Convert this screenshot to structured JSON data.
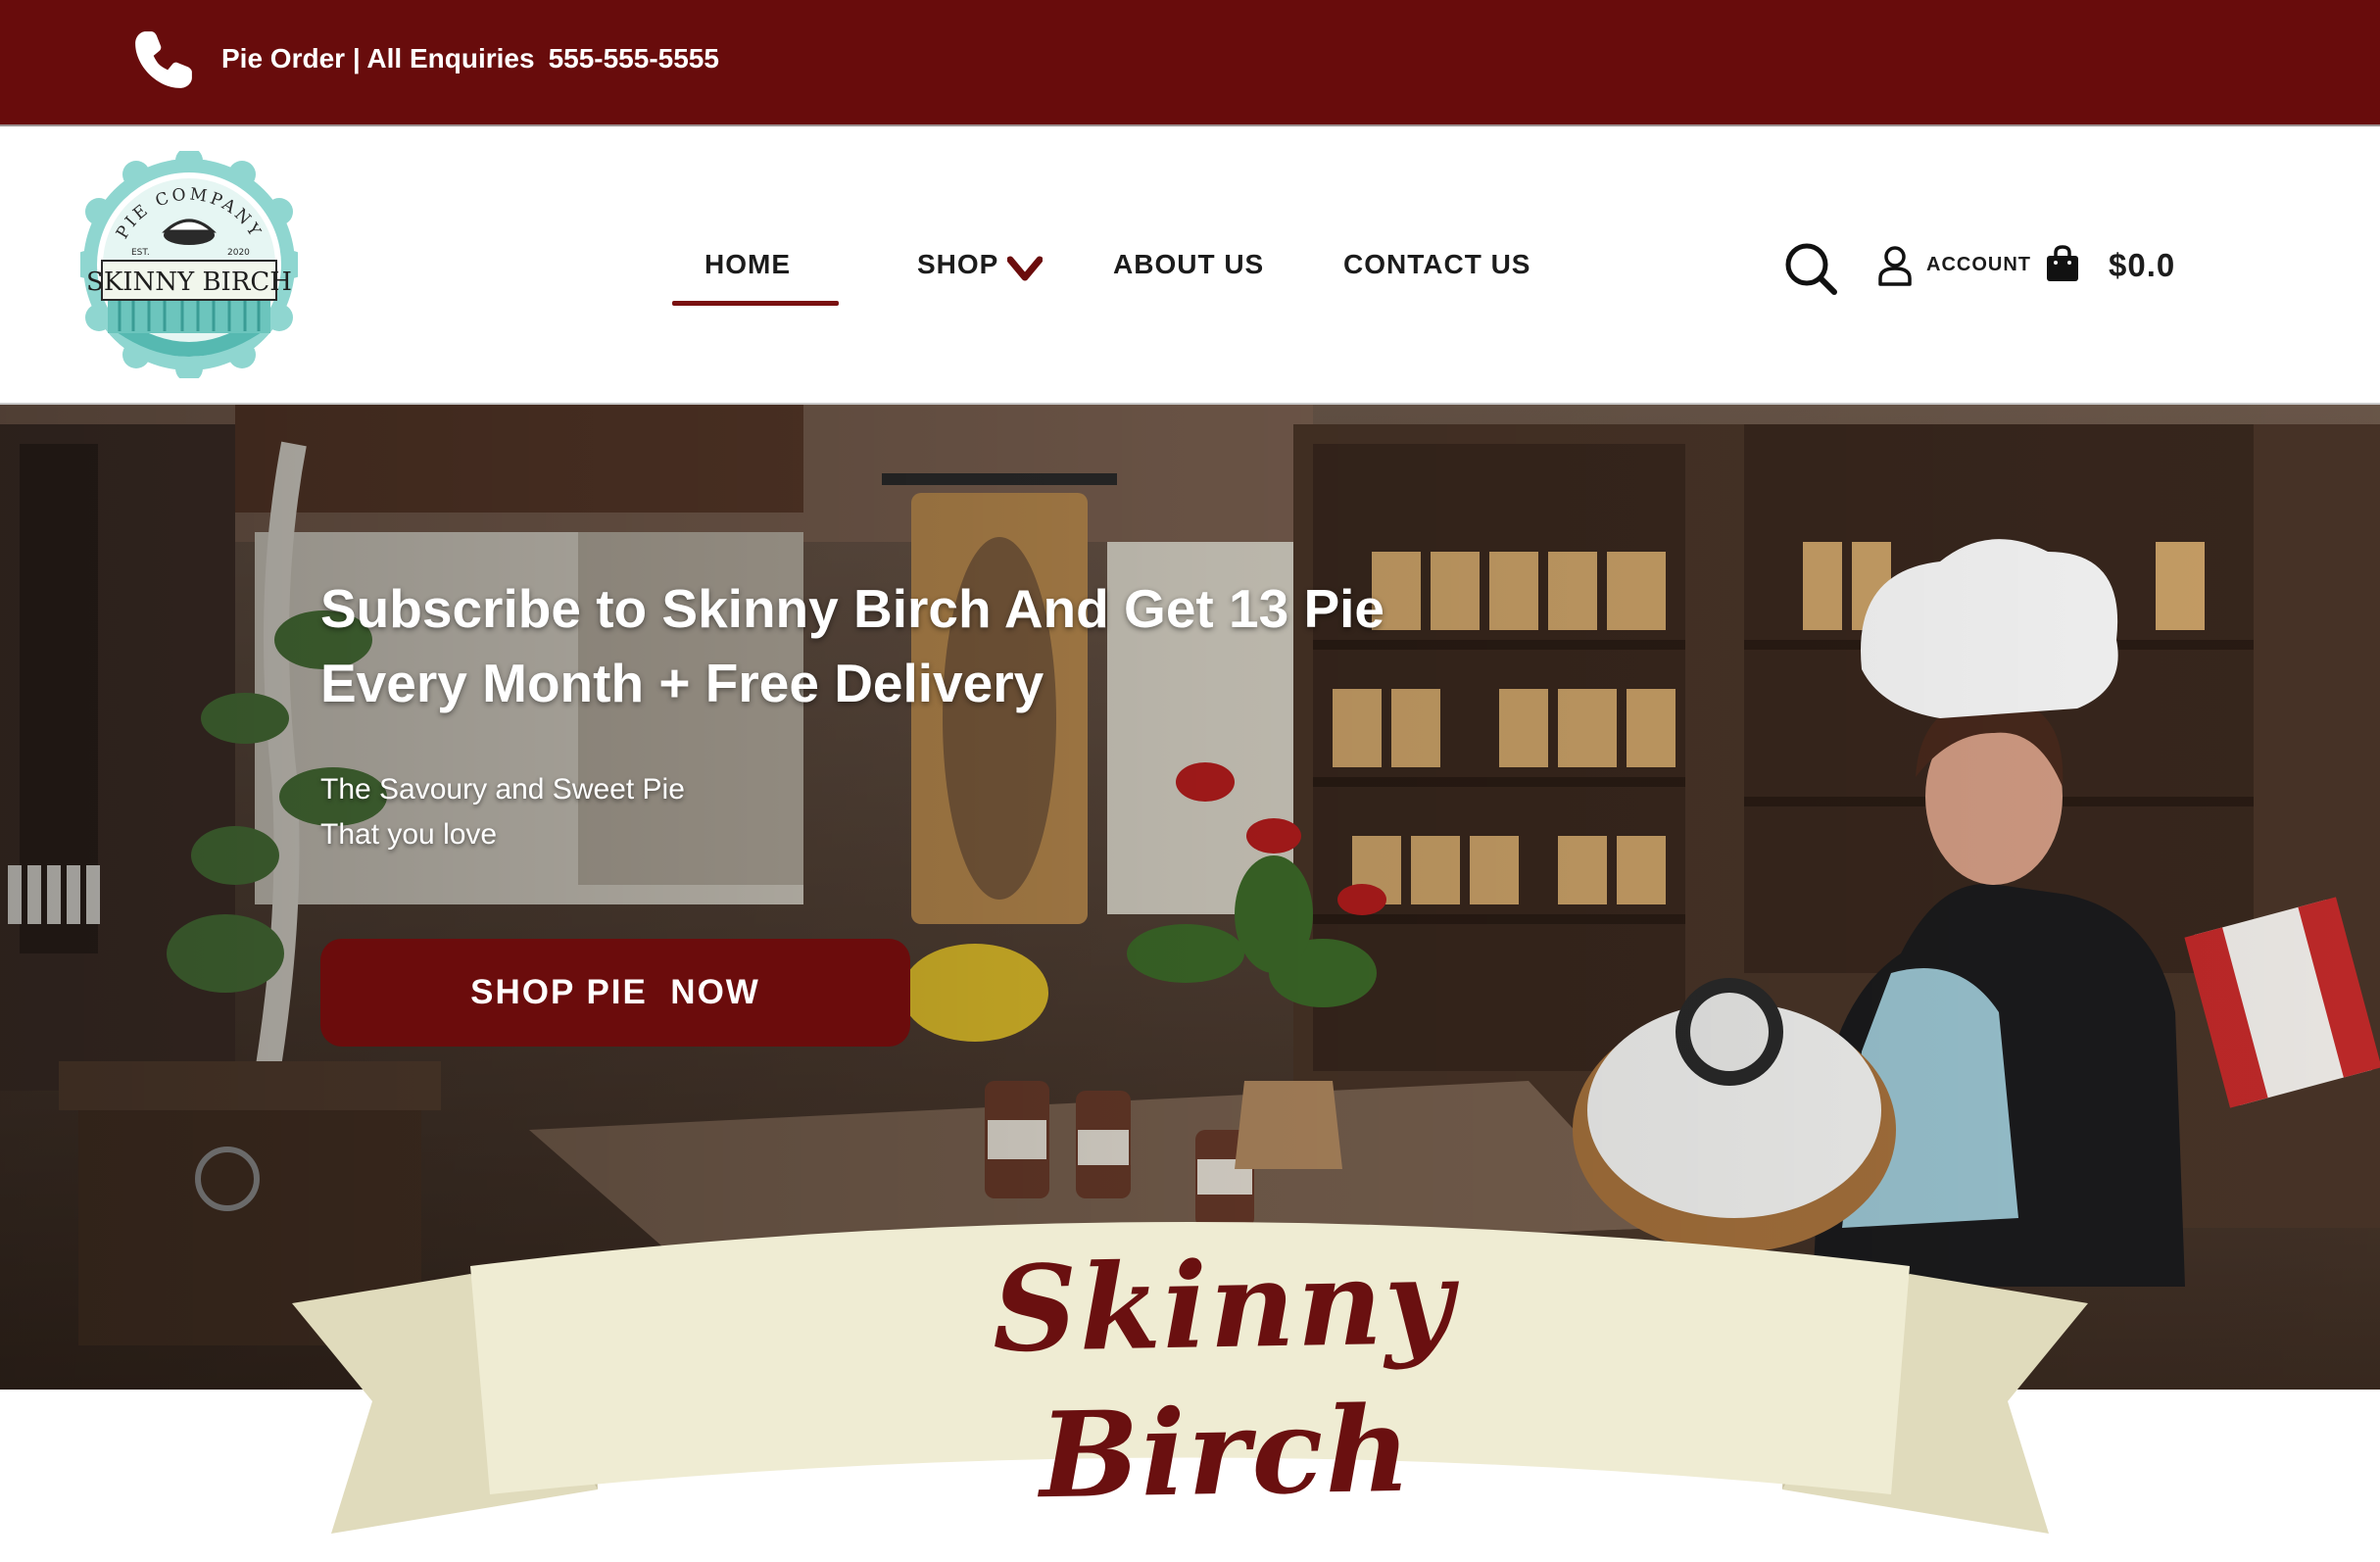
{
  "topbar": {
    "enquiries_label": "Pie Order | All Enquiries",
    "phone_number": "555-555-5555",
    "icon": "phone-icon"
  },
  "logo": {
    "arc_text": "PIE COMPANY",
    "est_label": "EST.",
    "year": "2020",
    "name": "SKINNY BIRCH"
  },
  "nav": {
    "items": [
      {
        "label": "HOME",
        "active": true
      },
      {
        "label": "SHOP",
        "has_dropdown": true
      },
      {
        "label": "ABOUT US"
      },
      {
        "label": "CONTACT US"
      }
    ]
  },
  "tools": {
    "account_label": "ACCOUNT",
    "cart_total": "$0.0",
    "icons": [
      "search-icon",
      "user-icon",
      "shopping-bag-icon"
    ]
  },
  "hero": {
    "title_line1": "Subscribe to Skinny Birch And Get 13 Pie",
    "title_line2": "Every Month + Free Delivery",
    "subtitle_line1": "The Savoury and Sweet Pie",
    "subtitle_line2": "That you love",
    "cta_label": "SHOP PIE  NOW"
  },
  "banner": {
    "text": "Skinny Birch"
  },
  "colors": {
    "brand_maroon": "#680c0c",
    "banner_cream": "#efecd3",
    "logo_teal": "#8fd6d0"
  }
}
